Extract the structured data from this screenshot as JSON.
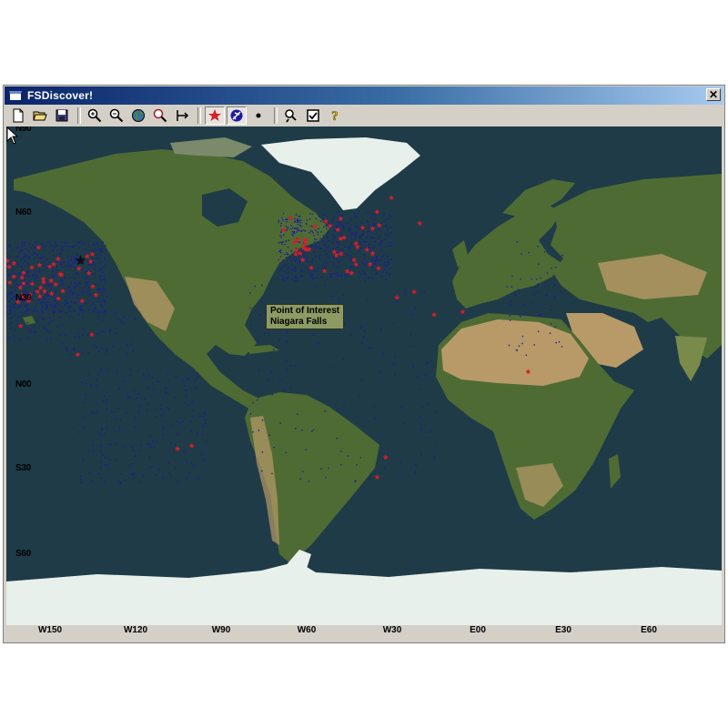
{
  "window": {
    "title": "FSDiscover!",
    "close_glyph": "✕"
  },
  "toolbar": {
    "buttons": [
      {
        "name": "new-file",
        "icon": "new-document-icon",
        "glyph": "🗋"
      },
      {
        "name": "open-file",
        "icon": "open-folder-icon",
        "glyph": "📂"
      },
      {
        "name": "save-file",
        "icon": "save-disk-icon",
        "glyph": "💾"
      },
      {
        "name": "zoom-in",
        "icon": "zoom-in-icon",
        "glyph": "⊕"
      },
      {
        "name": "zoom-out",
        "icon": "zoom-out-icon",
        "glyph": "⊖"
      },
      {
        "name": "whole-world",
        "icon": "globe-icon",
        "glyph": "◍"
      },
      {
        "name": "zoom-region",
        "icon": "zoom-region-icon",
        "glyph": "⌕"
      },
      {
        "name": "pan",
        "icon": "pan-icon",
        "glyph": "⊣"
      },
      {
        "name": "points-of-interest",
        "icon": "red-star-icon",
        "glyph": "★"
      },
      {
        "name": "airports",
        "icon": "airport-icon",
        "glyph": "✈"
      },
      {
        "name": "dots",
        "icon": "dot-icon",
        "glyph": "•"
      },
      {
        "name": "find",
        "icon": "find-icon",
        "glyph": "⌕"
      },
      {
        "name": "options",
        "icon": "checkbox-icon",
        "glyph": "☑"
      },
      {
        "name": "help",
        "icon": "help-icon",
        "glyph": "?"
      }
    ]
  },
  "map": {
    "lat_labels": [
      "N90",
      "N60",
      "N30",
      "N00",
      "S30",
      "S60"
    ],
    "lon_labels": [
      "W150",
      "W120",
      "W90",
      "W60",
      "W30",
      "E00",
      "E30",
      "E60"
    ],
    "tooltip": {
      "line1": "Point of Interest",
      "line2": "Niagara Falls"
    },
    "colors": {
      "ocean": "#1f3b47",
      "land_forest": "#4f6b34",
      "land_desert": "#b89a68",
      "ice": "#e8f0ec",
      "poi_star": "#d4202a",
      "airport_dot": "#1a1aa0"
    }
  }
}
